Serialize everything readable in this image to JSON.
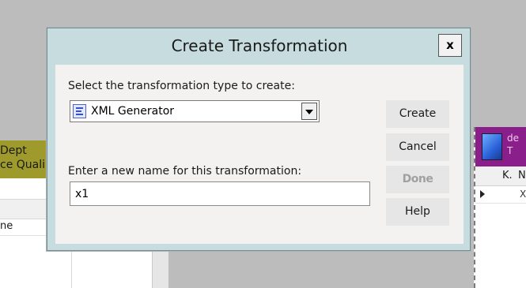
{
  "background": {
    "left_table": {
      "header_lines": [
        "Dept",
        "ce Quali"
      ],
      "row_text": "ne"
    },
    "right_table": {
      "header_lines": [
        "de",
        "T"
      ],
      "columns": [
        "K.",
        "N"
      ],
      "row_cell": "X"
    }
  },
  "dialog": {
    "title": "Create Transformation",
    "close_label": "x",
    "type_label": "Select the transformation type to create:",
    "type_select": {
      "icon": "xml-generator-icon",
      "selected": "XML Generator"
    },
    "name_label": "Enter a new name for this transformation:",
    "name_input": {
      "value": "x1"
    },
    "buttons": {
      "create": "Create",
      "cancel": "Cancel",
      "done": "Done",
      "help": "Help"
    }
  }
}
